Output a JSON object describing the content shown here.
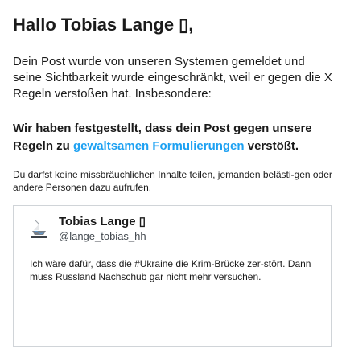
{
  "greeting": "Hallo Tobias Lange ▯,",
  "intro": "Dein Post wurde von unseren Systemen gemeldet und seine Sichtbarkeit wurde eingeschränkt, weil er gegen die X Regeln verstoßen hat. Insbesondere:",
  "finding": {
    "prefix": "Wir haben festgestellt, dass dein Post gegen unsere Regeln zu ",
    "link": "gewaltsamen Formulierungen",
    "suffix": " verstößt."
  },
  "rule_note": "Du darfst keine missbräuchlichen Inhalte teilen, jemanden belästi-gen oder andere Personen dazu aufrufen.",
  "tweet": {
    "author_name": "Tobias Lange ▯",
    "handle": "@lange_tobias_hh",
    "text": "Ich wäre dafür, dass die #Ukraine die Krim-Brücke zer-stört. Dann muss Russland Nachschub gar nicht mehr versuchen.",
    "avatar_icon": "boat-avatar-icon"
  },
  "colors": {
    "link": "#1da1f2",
    "text": "#1a1a1a",
    "border": "#d0d4d8",
    "secondary_text": "#444a50"
  }
}
